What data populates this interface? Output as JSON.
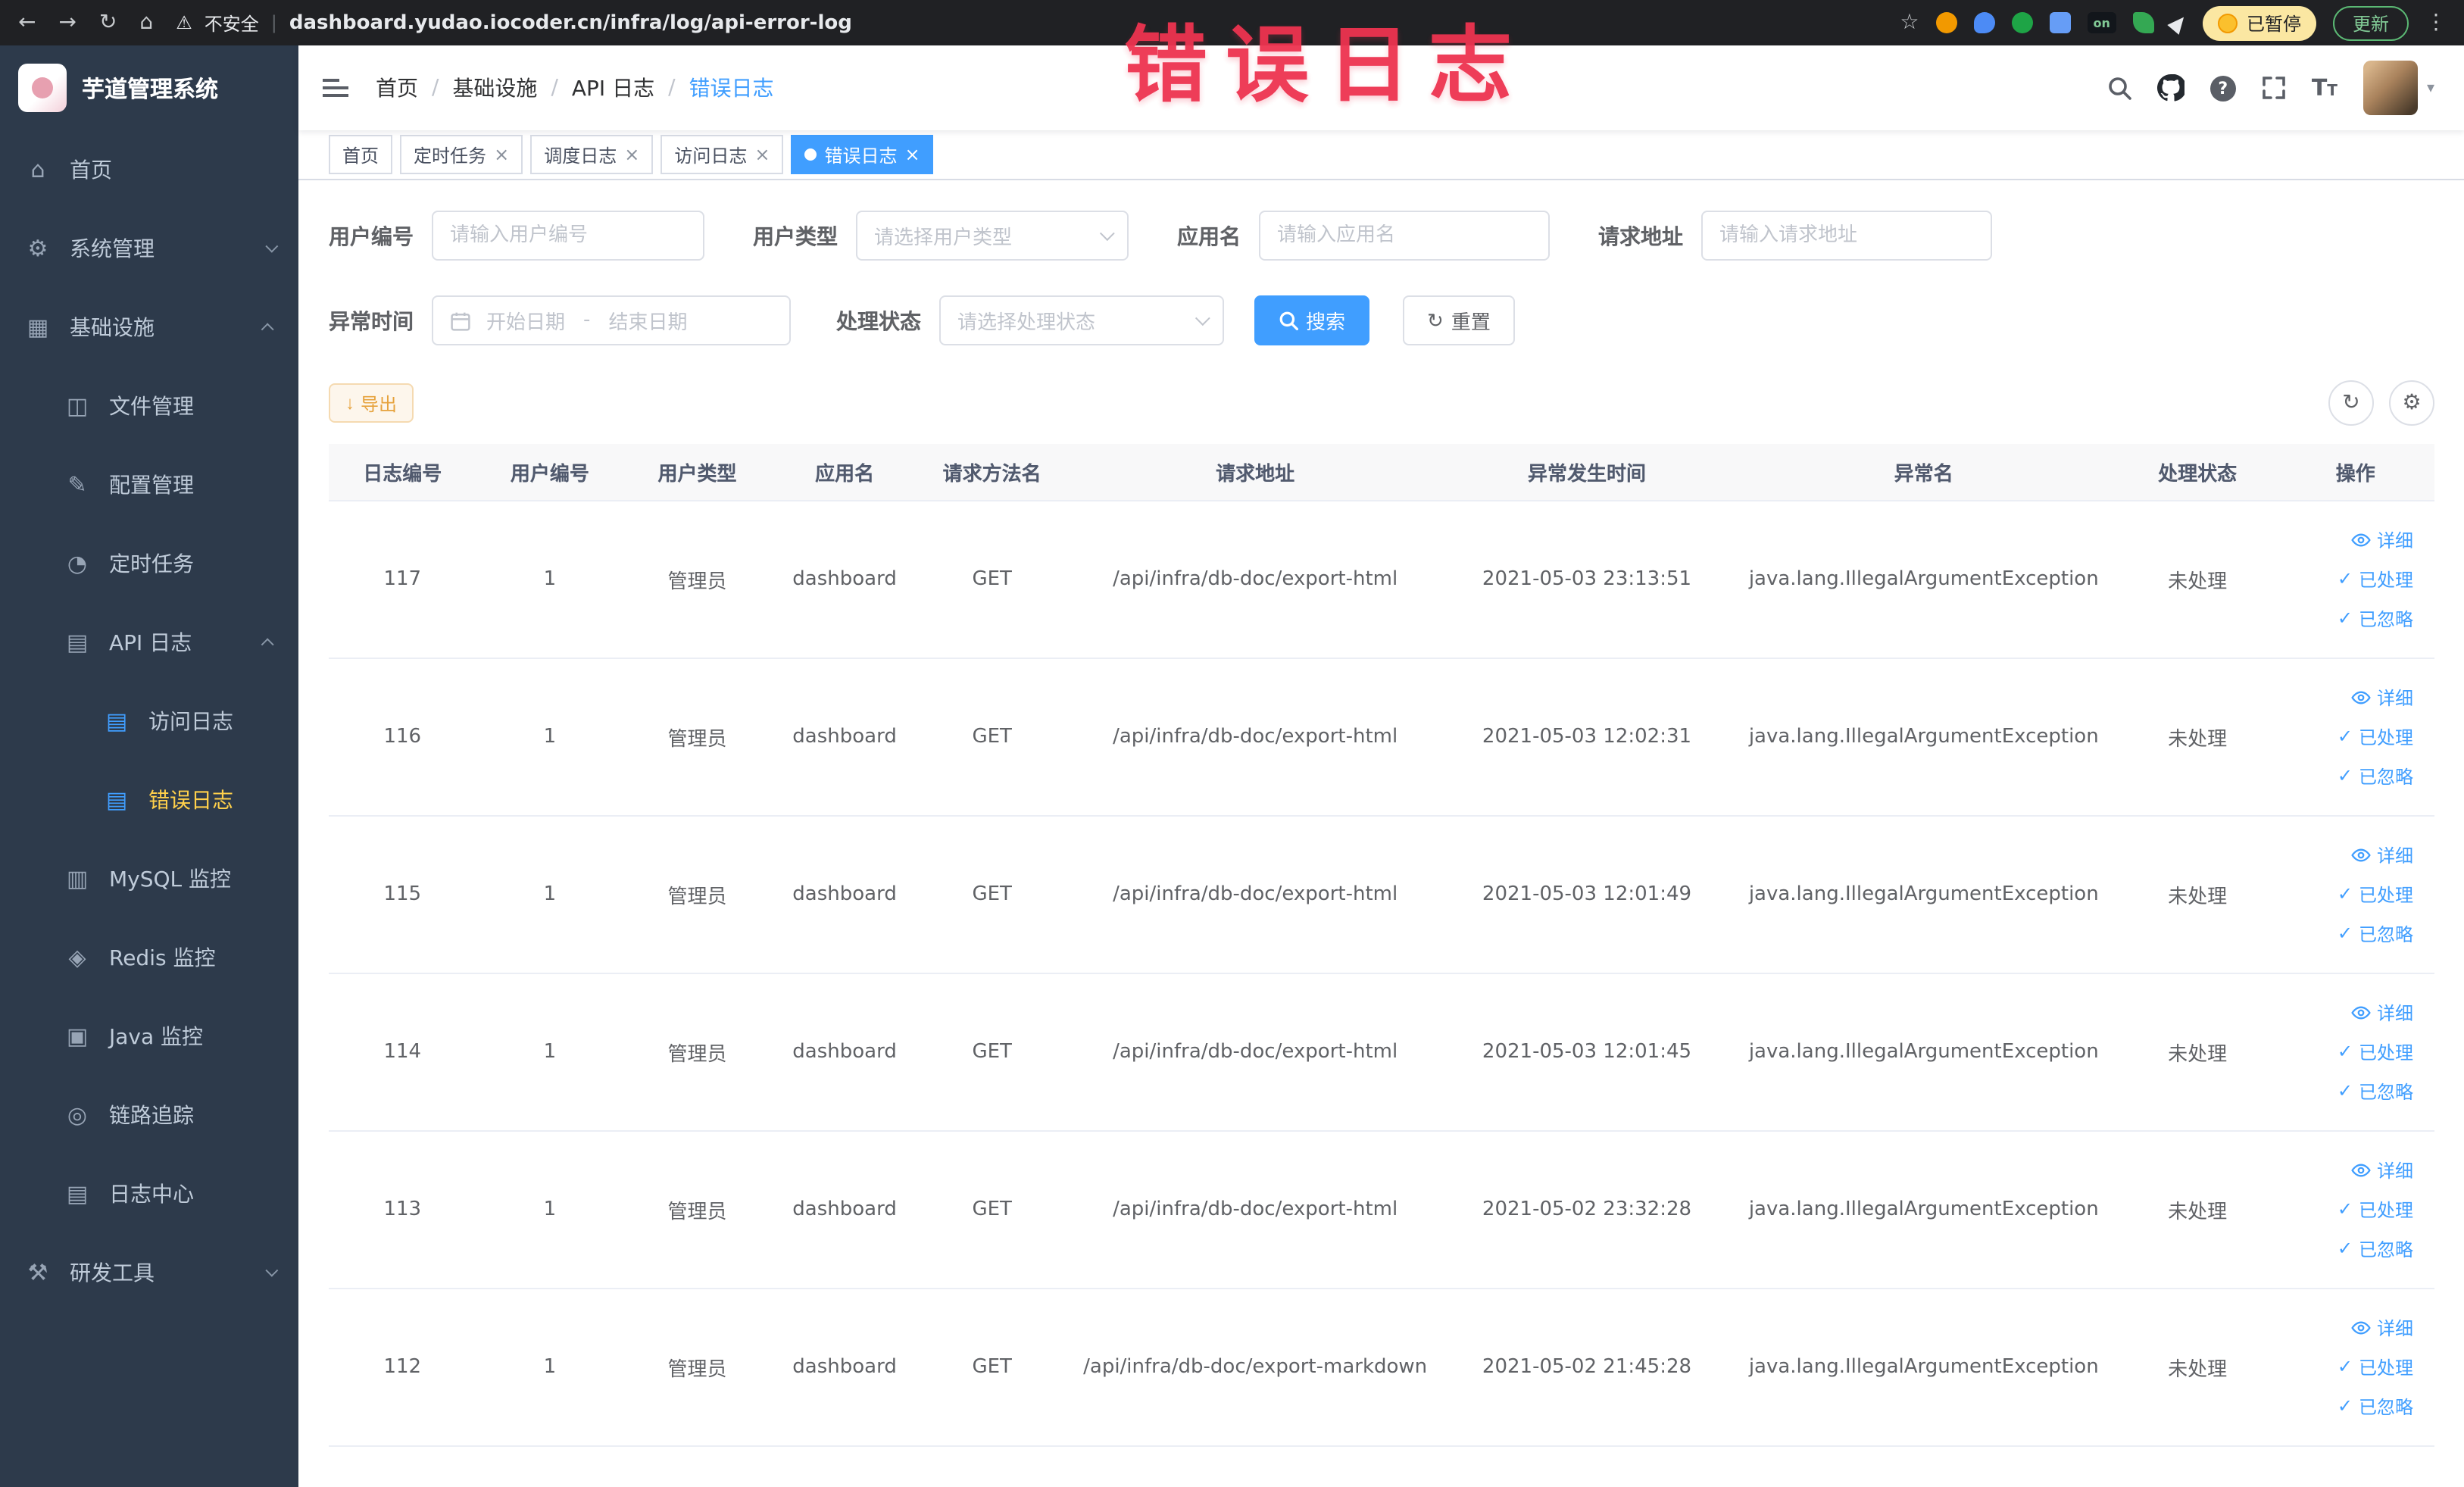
{
  "annotation": {
    "text": "错误日志"
  },
  "browser": {
    "security_label": "不安全",
    "url": "dashboard.yudao.iocoder.cn/infra/log/api-error-log",
    "paused_badge": "已暂停",
    "update_button": "更新",
    "extension_on": "on"
  },
  "icons": {
    "back": "←",
    "forward": "→",
    "reload": "↻",
    "home": "⌂",
    "warning": "⚠",
    "star": "☆",
    "pipe": "|",
    "dots": "⋮",
    "question": "?",
    "caret": "▾",
    "close": "×",
    "check": "✓",
    "download": "↓",
    "refresh": "↻",
    "gear": "⚙",
    "letter_T": "T"
  },
  "sidebar": {
    "title": "芋道管理系统",
    "items": [
      {
        "label": "首页",
        "icon": "⌂"
      },
      {
        "label": "系统管理",
        "icon": "⚙"
      },
      {
        "label": "基础设施",
        "icon": "▦"
      },
      {
        "label": "文件管理",
        "icon": "◫"
      },
      {
        "label": "配置管理",
        "icon": "✎"
      },
      {
        "label": "定时任务",
        "icon": "◔"
      },
      {
        "label": "API 日志",
        "icon": "▤"
      },
      {
        "label": "访问日志",
        "icon": "▤"
      },
      {
        "label": "错误日志",
        "icon": "▤"
      },
      {
        "label": "MySQL 监控",
        "icon": "▥"
      },
      {
        "label": "Redis 监控",
        "icon": "◈"
      },
      {
        "label": "Java 监控",
        "icon": "▣"
      },
      {
        "label": "链路追踪",
        "icon": "◎"
      },
      {
        "label": "日志中心",
        "icon": "▤"
      },
      {
        "label": "研发工具",
        "icon": "⚒"
      }
    ]
  },
  "header": {
    "breadcrumb": [
      "首页",
      "基础设施",
      "API 日志",
      "错误日志"
    ],
    "separator": "/"
  },
  "tabs": [
    {
      "label": "首页"
    },
    {
      "label": "定时任务"
    },
    {
      "label": "调度日志"
    },
    {
      "label": "访问日志"
    },
    {
      "label": "错误日志"
    }
  ],
  "filters": {
    "user_id": {
      "label": "用户编号",
      "placeholder": "请输入用户编号"
    },
    "user_type": {
      "label": "用户类型",
      "placeholder": "请选择用户类型"
    },
    "app_name": {
      "label": "应用名",
      "placeholder": "请输入应用名"
    },
    "request_url": {
      "label": "请求地址",
      "placeholder": "请输入请求地址"
    },
    "exception_time": {
      "label": "异常时间",
      "start_placeholder": "开始日期",
      "separator": "-",
      "end_placeholder": "结束日期"
    },
    "process_status": {
      "label": "处理状态",
      "placeholder": "请选择处理状态"
    },
    "search_button": "搜索",
    "reset_button": "重置"
  },
  "toolbar": {
    "export_button": "导出"
  },
  "table": {
    "columns": [
      "日志编号",
      "用户编号",
      "用户类型",
      "应用名",
      "请求方法名",
      "请求地址",
      "异常发生时间",
      "异常名",
      "处理状态",
      "操作"
    ],
    "actions": [
      "详细",
      "已处理",
      "已忽略"
    ],
    "rows": [
      {
        "id": "117",
        "user_id": "1",
        "user_type": "管理员",
        "app": "dashboard",
        "method": "GET",
        "url": "/api/infra/db-doc/export-html",
        "time": "2021-05-03 23:13:51",
        "exception": "java.lang.IllegalArgumentException",
        "status": "未处理"
      },
      {
        "id": "116",
        "user_id": "1",
        "user_type": "管理员",
        "app": "dashboard",
        "method": "GET",
        "url": "/api/infra/db-doc/export-html",
        "time": "2021-05-03 12:02:31",
        "exception": "java.lang.IllegalArgumentException",
        "status": "未处理"
      },
      {
        "id": "115",
        "user_id": "1",
        "user_type": "管理员",
        "app": "dashboard",
        "method": "GET",
        "url": "/api/infra/db-doc/export-html",
        "time": "2021-05-03 12:01:49",
        "exception": "java.lang.IllegalArgumentException",
        "status": "未处理"
      },
      {
        "id": "114",
        "user_id": "1",
        "user_type": "管理员",
        "app": "dashboard",
        "method": "GET",
        "url": "/api/infra/db-doc/export-html",
        "time": "2021-05-03 12:01:45",
        "exception": "java.lang.IllegalArgumentException",
        "status": "未处理"
      },
      {
        "id": "113",
        "user_id": "1",
        "user_type": "管理员",
        "app": "dashboard",
        "method": "GET",
        "url": "/api/infra/db-doc/export-html",
        "time": "2021-05-02 23:32:28",
        "exception": "java.lang.IllegalArgumentException",
        "status": "未处理"
      },
      {
        "id": "112",
        "user_id": "1",
        "user_type": "管理员",
        "app": "dashboard",
        "method": "GET",
        "url": "/api/infra/db-doc/export-markdown",
        "time": "2021-05-02 21:45:28",
        "exception": "java.lang.IllegalArgumentException",
        "status": "未处理"
      }
    ]
  }
}
